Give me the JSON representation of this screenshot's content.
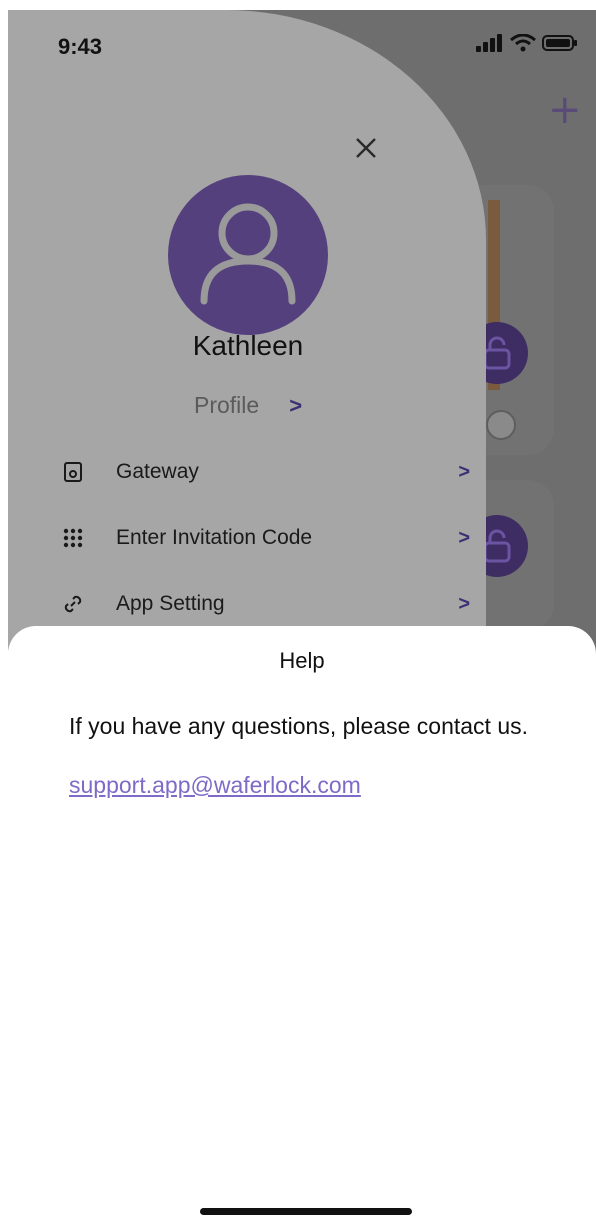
{
  "status_bar": {
    "time": "9:43"
  },
  "background_app": {
    "add_icon": "plus-icon"
  },
  "drawer": {
    "close_icon": "close-icon",
    "avatar_icon": "user-icon",
    "user_name": "Kathleen",
    "profile_label": "Profile",
    "chevron": ">",
    "menu": [
      {
        "label": "Gateway",
        "icon": "gateway-icon"
      },
      {
        "label": "Enter Invitation Code",
        "icon": "keypad-icon"
      },
      {
        "label": "App Setting",
        "icon": "link-icon"
      }
    ]
  },
  "help_sheet": {
    "title": "Help",
    "message": "If you have any questions, please contact us.",
    "email": "support.app@waferlock.com"
  },
  "colors": {
    "accent": "#55407e",
    "link": "#7e6bc7",
    "chevron": "#3c2f73",
    "drawer_bg": "#a6a6a6"
  }
}
